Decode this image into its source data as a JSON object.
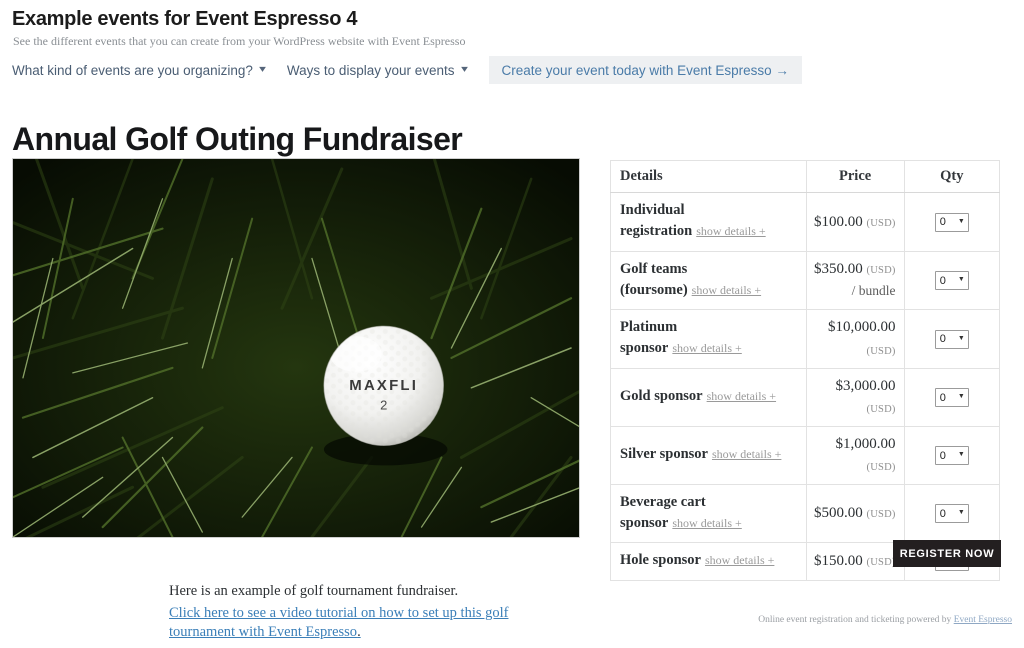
{
  "banner": {
    "title": "Example events for Event Espresso 4",
    "subtitle": "See the different events that you can create from your WordPress website with Event Espresso",
    "nav": [
      {
        "label": "What kind of events are you organizing?",
        "caret": "chevron-down-icon"
      },
      {
        "label": "Ways to display your events",
        "caret": "chevron-down-icon"
      }
    ],
    "cta": "Create your event today with Event Espresso →"
  },
  "page": {
    "title": "Annual Golf Outing Fundraiser"
  },
  "hero": {
    "alt": "Golf ball resting in dark green grass",
    "ball_brand": "MAXFLI",
    "ball_number": "2"
  },
  "table": {
    "headers": {
      "details": "Details",
      "price": "Price",
      "qty": "Qty"
    },
    "details_link_label": "show details +",
    "rows": [
      {
        "name": "Individual registration",
        "price": "$100.00",
        "currency": "(USD)",
        "per": "",
        "qty": "0"
      },
      {
        "name": "Golf teams (foursome)",
        "price": "$350.00",
        "currency": "(USD)",
        "per": "/ bundle",
        "qty": "0"
      },
      {
        "name": "Platinum sponsor",
        "price": "$10,000.00",
        "currency": "(USD)",
        "per": "",
        "qty": "0"
      },
      {
        "name": "Gold sponsor",
        "price": "$3,000.00",
        "currency": "(USD)",
        "per": "",
        "qty": "0"
      },
      {
        "name": "Silver sponsor",
        "price": "$1,000.00",
        "currency": "(USD)",
        "per": "",
        "qty": "0"
      },
      {
        "name": "Beverage cart sponsor",
        "price": "$500.00",
        "currency": "(USD)",
        "per": "",
        "qty": "0"
      },
      {
        "name": "Hole sponsor",
        "price": "$150.00",
        "currency": "(USD)",
        "per": "",
        "qty": "0"
      }
    ]
  },
  "register": {
    "label": "REGISTER NOW"
  },
  "content": {
    "paragraph": "Here is an example of golf tournament fundraiser.",
    "video_link": "Click here to see a video tutorial on how to set up this golf tournament with Event Espresso",
    "video_link_tail": "."
  },
  "footer": {
    "attribution_prefix": "Online event registration and ticketing powered by ",
    "attribution_link": "Event Espresso"
  },
  "colors": {
    "accent_blue": "#4a7ba8",
    "link_blue": "#3b7fb8",
    "button_dark": "#231f20",
    "muted_gray": "#9a9a9a",
    "table_border": "#e2e2e2"
  }
}
